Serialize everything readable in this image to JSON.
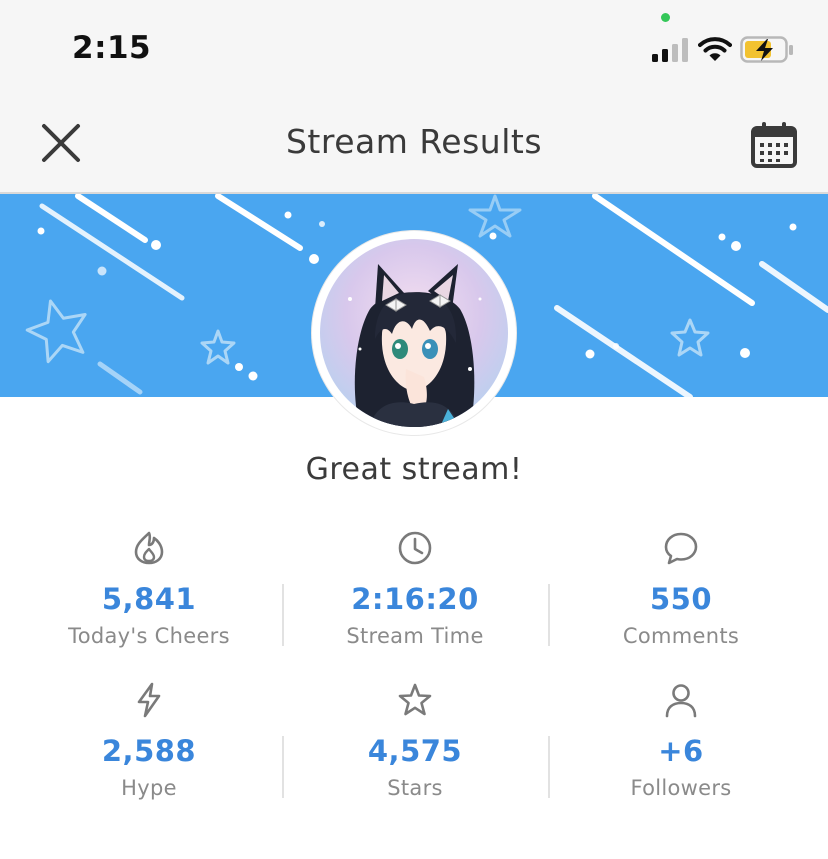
{
  "status_bar": {
    "time": "2:15"
  },
  "nav": {
    "title": "Stream Results",
    "close_icon": "close-icon",
    "calendar_icon": "calendar-icon"
  },
  "greeting": "Great stream!",
  "stats": [
    {
      "icon": "flame-icon",
      "value": "5,841",
      "label": "Today's Cheers"
    },
    {
      "icon": "clock-icon",
      "value": "2:16:20",
      "label": "Stream Time"
    },
    {
      "icon": "comment-icon",
      "value": "550",
      "label": "Comments"
    },
    {
      "icon": "lightning-icon",
      "value": "2,588",
      "label": "Hype"
    },
    {
      "icon": "star-icon",
      "value": "4,575",
      "label": "Stars"
    },
    {
      "icon": "person-icon",
      "value": "+6",
      "label": "Followers"
    }
  ],
  "colors": {
    "accent": "#3a86db",
    "banner": "#4aa6f0",
    "label": "#8a8a8a",
    "bar_bg": "#f6f6f6"
  }
}
